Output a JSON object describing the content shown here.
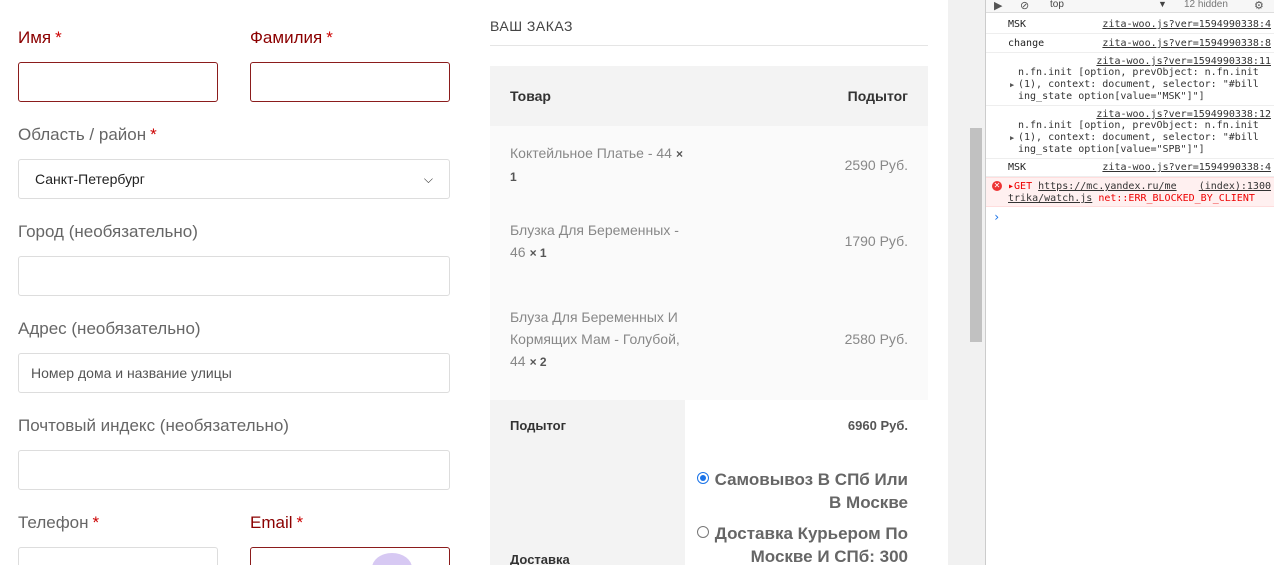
{
  "form": {
    "first_name_label": "Имя",
    "last_name_label": "Фамилия",
    "region_label": "Область / район",
    "region_value": "Санкт-Петербург",
    "city_label": "Город (необязательно)",
    "address_label": "Адрес (необязательно)",
    "address_placeholder": "Номер дома и название улицы",
    "postcode_label": "Почтовый индекс (необязательно)",
    "phone_label": "Телефон",
    "email_label": "Email",
    "required_mark": "*"
  },
  "order": {
    "title": "ВАШ ЗАКАЗ",
    "col_product": "Товар",
    "col_subtotal": "Подытог",
    "items": [
      {
        "name": "Коктейльное Платье - 44",
        "qty": "× 1",
        "price": "2590 Руб."
      },
      {
        "name": "Блузка Для Беременных - 46",
        "qty": "× 1",
        "price": "1790 Руб."
      },
      {
        "name": "Блуза Для Беременных И Кормящих Мам - Голубой, 44",
        "qty": "× 2",
        "price": "2580 Руб."
      }
    ],
    "subtotal_label": "Подытог",
    "subtotal_value": "6960 Руб.",
    "shipping_label": "Доставка",
    "shipping_options": [
      {
        "label": "Самовывоз В СПб Или В Москве",
        "selected": true
      },
      {
        "label": "Доставка Курьером По Москве И СПб: 300",
        "selected": false
      }
    ]
  },
  "devtools": {
    "context": "top",
    "hidden_count": "12 hidden",
    "lines": [
      {
        "msg": "MSK",
        "src": "zita-woo.js?ver=1594990338:4"
      },
      {
        "msg": "change",
        "src": "zita-woo.js?ver=1594990338:8"
      },
      {
        "src": "zita-woo.js?ver=1594990338:11",
        "code1": "n.fn.init [option, prevObject: n.fn.init",
        "code2": "(1), context: document, selector: \"#bill",
        "code3": "ing_state option[value=\"MSK\"]\"]"
      },
      {
        "src": "zita-woo.js?ver=1594990338:12",
        "code1": "n.fn.init [option, prevObject: n.fn.init",
        "code2": "(1), context: document, selector: \"#bill",
        "code3": "ing_state option[value=\"SPB\"]\"]"
      },
      {
        "msg": "MSK",
        "src": "zita-woo.js?ver=1594990338:4"
      }
    ],
    "error": {
      "method": "GET",
      "url": "https://mc.yandex.ru/me",
      "url2": "trika/watch.js",
      "src": "(index):1300",
      "message": "net::ERR_BLOCKED_BY_CLIENT"
    }
  }
}
